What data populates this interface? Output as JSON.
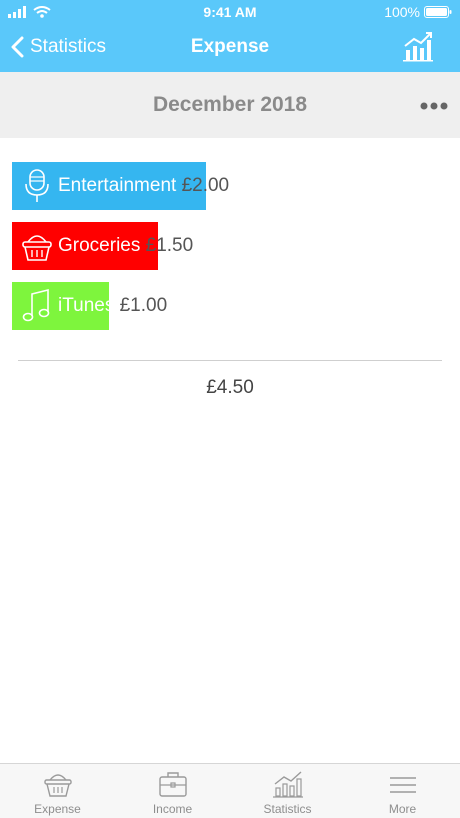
{
  "status_bar": {
    "time": "9:41 AM",
    "battery": "100%"
  },
  "nav": {
    "back_label": "Statistics",
    "title": "Expense"
  },
  "period": {
    "title": "December 2018"
  },
  "expenses": [
    {
      "name": "Entertainment",
      "amount": "£2.00",
      "value": 2.0,
      "color": "#35b6f0",
      "icon": "microphone-icon"
    },
    {
      "name": "Groceries",
      "amount": "£1.50",
      "value": 1.5,
      "color": "#ff0000",
      "icon": "basket-icon"
    },
    {
      "name": "iTunes",
      "amount": "£1.00",
      "value": 1.0,
      "color": "#7ef53d",
      "icon": "music-note-icon"
    }
  ],
  "total": "£4.50",
  "tabs": [
    {
      "label": "Expense",
      "icon": "basket-icon"
    },
    {
      "label": "Income",
      "icon": "briefcase-icon"
    },
    {
      "label": "Statistics",
      "icon": "bar-chart-icon"
    },
    {
      "label": "More",
      "icon": "menu-icon"
    }
  ],
  "colors": {
    "header": "#5ac8fa",
    "period_bg": "#efefef",
    "tab_bg": "#f7f7f7"
  }
}
